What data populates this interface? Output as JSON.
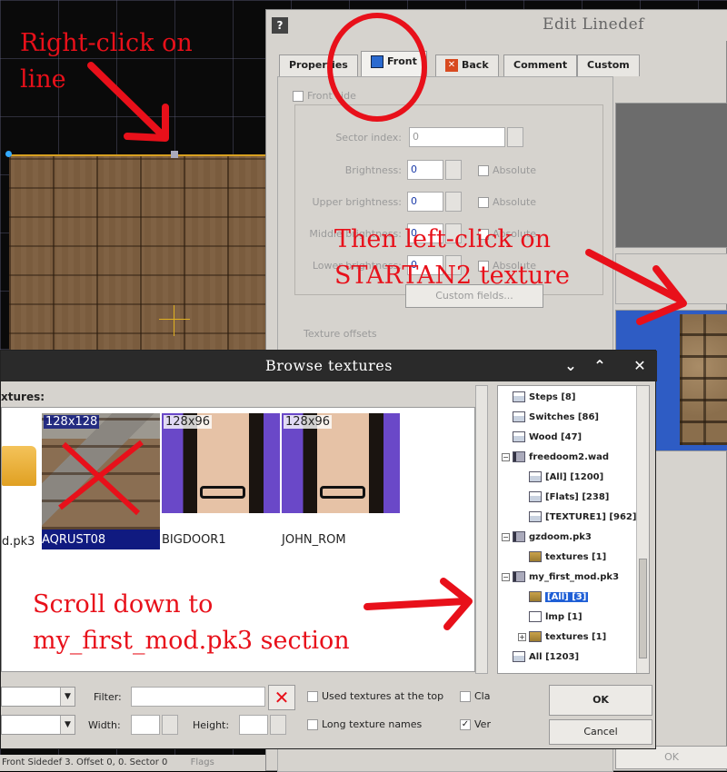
{
  "editor": {
    "status_text": "Front Sidedef 3. Offset 0, 0. Sector 0",
    "flags_label": "Flags"
  },
  "linedef_dialog": {
    "help_label": "?",
    "title": "Edit Linedef",
    "tabs": [
      {
        "label": "Properties"
      },
      {
        "label": "Front"
      },
      {
        "label": "Back"
      },
      {
        "label": "Comment"
      },
      {
        "label": "Custom"
      }
    ],
    "front_side_label": "Front side",
    "sector_index_label": "Sector index:",
    "sector_index_value": "0",
    "brightness_label": "Brightness:",
    "brightness_value": "0",
    "upper_brightness_label": "Upper brightness:",
    "upper_brightness_value": "0",
    "middle_brightness_label": "Middle brightness:",
    "middle_brightness_value": "0",
    "lower_brightness_label": "Lower brightness:",
    "lower_brightness_value": "0",
    "absolute_label": "Absolute",
    "custom_fields_label": "Custom fields...",
    "texture_offsets_label": "Texture offsets",
    "ok_label": "OK"
  },
  "browse_dialog": {
    "title": "Browse textures",
    "textures_label": "xtures:",
    "tiles": [
      {
        "size": "",
        "name": "d.pk3"
      },
      {
        "size": "128x128",
        "name": "AQRUST08"
      },
      {
        "size": "128x96",
        "name": "BIGDOOR1"
      },
      {
        "size": "128x96",
        "name": "JOHN_ROM"
      }
    ],
    "tree": [
      {
        "label": "Steps [8]"
      },
      {
        "label": "Switches [86]"
      },
      {
        "label": "Wood [47]"
      },
      {
        "label": "freedoom2.wad",
        "expander": "−"
      },
      {
        "label": "[All] [1200]"
      },
      {
        "label": "[Flats] [238]"
      },
      {
        "label": "[TEXTURE1] [962]"
      },
      {
        "label": "gzdoom.pk3",
        "expander": "−"
      },
      {
        "label": "textures [1]"
      },
      {
        "label": "my_first_mod.pk3",
        "expander": "−"
      },
      {
        "label": "[All] [3]"
      },
      {
        "label": "lmp [1]"
      },
      {
        "label": "textures [1]",
        "expander": "+"
      },
      {
        "label": "All [1203]"
      }
    ],
    "filter_label": "Filter:",
    "filter_value": "",
    "width_label": "Width:",
    "height_label": "Height:",
    "used_textures_label": "Used textures at the top",
    "long_names_label": "Long texture names",
    "cla_label": "Cla",
    "ver_label": "Ver",
    "ok_label": "OK",
    "cancel_label": "Cancel"
  },
  "annotations": {
    "right_click": "Right-click on line",
    "left_click": "Then left-click on STARTAN2 texture",
    "scroll_down": "Scroll down to my_first_mod.pk3 section"
  },
  "colors": {
    "annotation_red": "#e8101a",
    "selection_blue": "#1f5fd6",
    "tile_selected": "#101a80"
  }
}
